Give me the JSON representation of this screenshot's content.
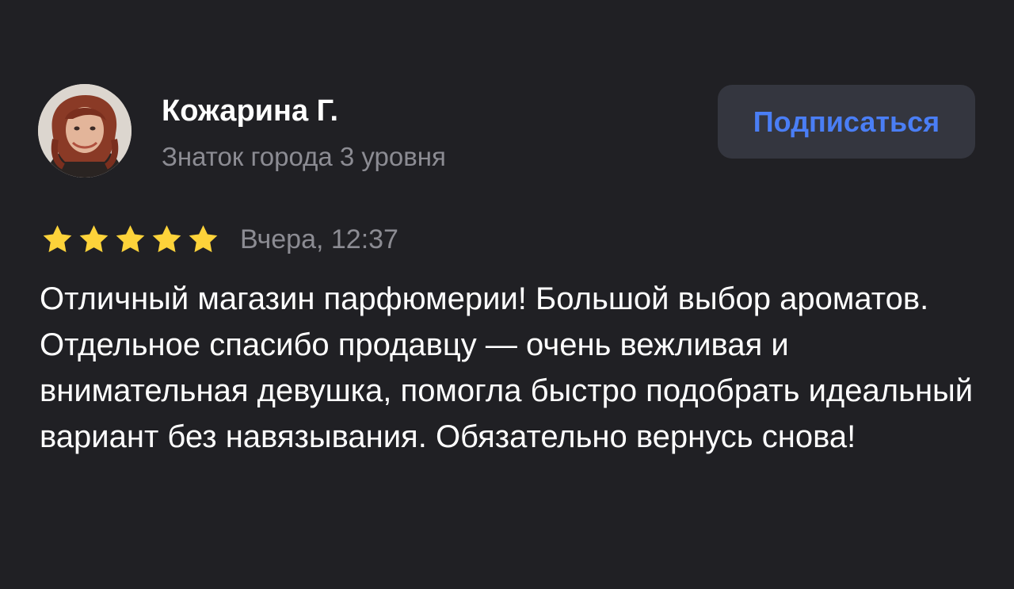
{
  "review": {
    "author": {
      "name": "Кожарина Г.",
      "level": "Знаток города 3 уровня",
      "avatar_icon": "user-photo-avatar"
    },
    "subscribe_label": "Подписаться",
    "rating": 5,
    "rating_max": 5,
    "date": "Вчера, 12:37",
    "text": "Отличный магазин парфюмерии! Большой выбор ароматов. Отдельное спасибо продавцу — очень вежливая и внимательная девушка, помогла быстро подобрать идеальный вариант без навязывания. Обязательно вернусь снова!"
  },
  "colors": {
    "background": "#202024",
    "button_background": "#34363f",
    "button_text": "#4a7ef5",
    "secondary_text": "#8c8c93",
    "star": "#fdd33a"
  }
}
